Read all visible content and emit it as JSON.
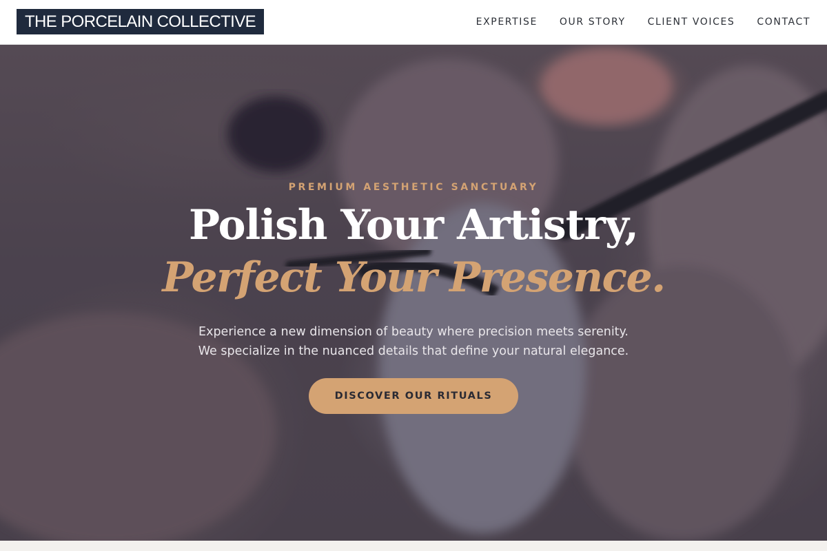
{
  "header": {
    "brand": "THE PORCELAIN COLLECTIVE",
    "nav": [
      {
        "label": "EXPERTISE"
      },
      {
        "label": "OUR STORY"
      },
      {
        "label": "CLIENT VOICES"
      },
      {
        "label": "CONTACT"
      }
    ]
  },
  "hero": {
    "eyebrow": "PREMIUM AESTHETIC SANCTUARY",
    "headline_line1": "Polish Your Artistry,",
    "headline_line2": "Perfect Your Presence.",
    "subcopy_line1": "Experience a new dimension of beauty where precision meets serenity.",
    "subcopy_line2": "We specialize in the nuanced details that define your natural elegance.",
    "cta_label": "DISCOVER OUR RITUALS"
  },
  "colors": {
    "brand_bg": "#1f2a3d",
    "accent": "#d4a373",
    "nav_text": "#2b2f36",
    "headline": "#ffffff"
  }
}
